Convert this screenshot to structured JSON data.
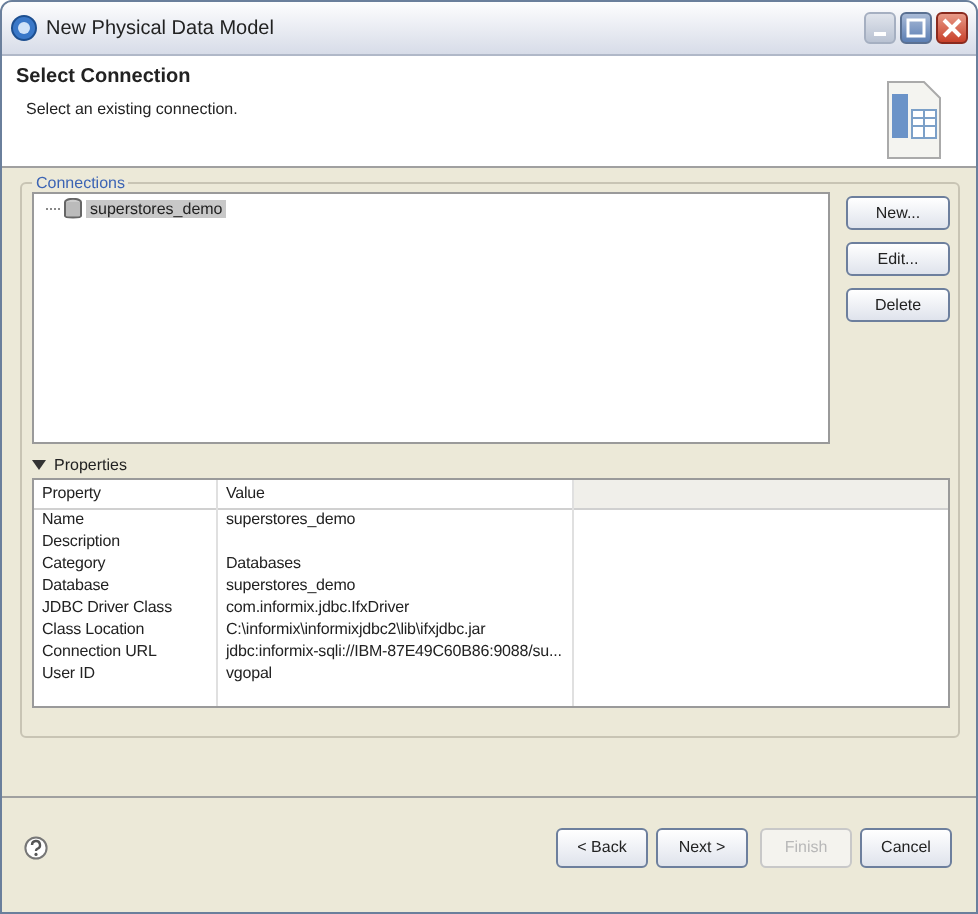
{
  "window": {
    "title": "New Physical Data Model"
  },
  "header": {
    "title": "Select Connection",
    "description": "Select an existing connection."
  },
  "connections": {
    "label": "Connections",
    "items": [
      {
        "name": "superstores_demo",
        "selected": true
      }
    ]
  },
  "side_buttons": [
    {
      "label": "New..."
    },
    {
      "label": "Edit..."
    },
    {
      "label": "Delete"
    }
  ],
  "properties": {
    "label": "Properties",
    "expanded": true,
    "columns": [
      "Property",
      "Value"
    ],
    "rows": [
      {
        "property": "Name",
        "value": "superstores_demo"
      },
      {
        "property": "Description",
        "value": ""
      },
      {
        "property": "Category",
        "value": "Databases"
      },
      {
        "property": "Database",
        "value": "superstores_demo"
      },
      {
        "property": "JDBC Driver Class",
        "value": "com.informix.jdbc.IfxDriver"
      },
      {
        "property": "Class Location",
        "value": "C:\\informix\\informixjdbc2\\lib\\ifxjdbc.jar"
      },
      {
        "property": "Connection URL",
        "value": "jdbc:informix-sqli://IBM-87E49C60B86:9088/su..."
      },
      {
        "property": "User ID",
        "value": "vgopal"
      }
    ]
  },
  "buttons": [
    {
      "label": "< Back",
      "disabled": false
    },
    {
      "label": "Next >",
      "disabled": false
    },
    {
      "label": "Finish",
      "disabled": true
    },
    {
      "label": "Cancel",
      "disabled": false
    }
  ]
}
